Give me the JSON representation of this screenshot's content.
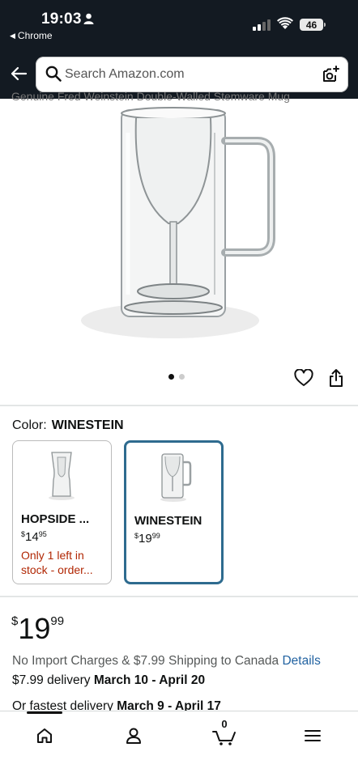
{
  "status": {
    "time": "19:03",
    "back_app": "Chrome",
    "battery": "46"
  },
  "search": {
    "placeholder": "Search Amazon.com"
  },
  "product": {
    "cut_title": "Genuine Fred Weinstein Double-Walled Stemware Mug"
  },
  "color": {
    "label": "Color:",
    "selected": "WINESTEIN"
  },
  "swatches": [
    {
      "name": "HOPSIDE ...",
      "currency": "$",
      "whole": "14",
      "cents": "95",
      "stock": "Only 1 left in stock - order..."
    },
    {
      "name": "WINESTEIN",
      "currency": "$",
      "whole": "19",
      "cents": "99",
      "stock": ""
    }
  ],
  "price": {
    "currency": "$",
    "whole": "19",
    "cents": "99"
  },
  "shipping": {
    "text": "No Import Charges & $7.99 Shipping to Canada",
    "link": "Details"
  },
  "delivery": {
    "prefix": "$7.99 delivery",
    "dates": "March 10 - April 20"
  },
  "fastest": {
    "prefix": "Or fastest delivery",
    "dates": "March 9 - April 17"
  },
  "cart": {
    "count": "0"
  },
  "colors": {
    "header_bg": "#131a22",
    "link": "#2162a1",
    "stock_red": "#b12704",
    "selected_border": "#2e6b8f"
  }
}
